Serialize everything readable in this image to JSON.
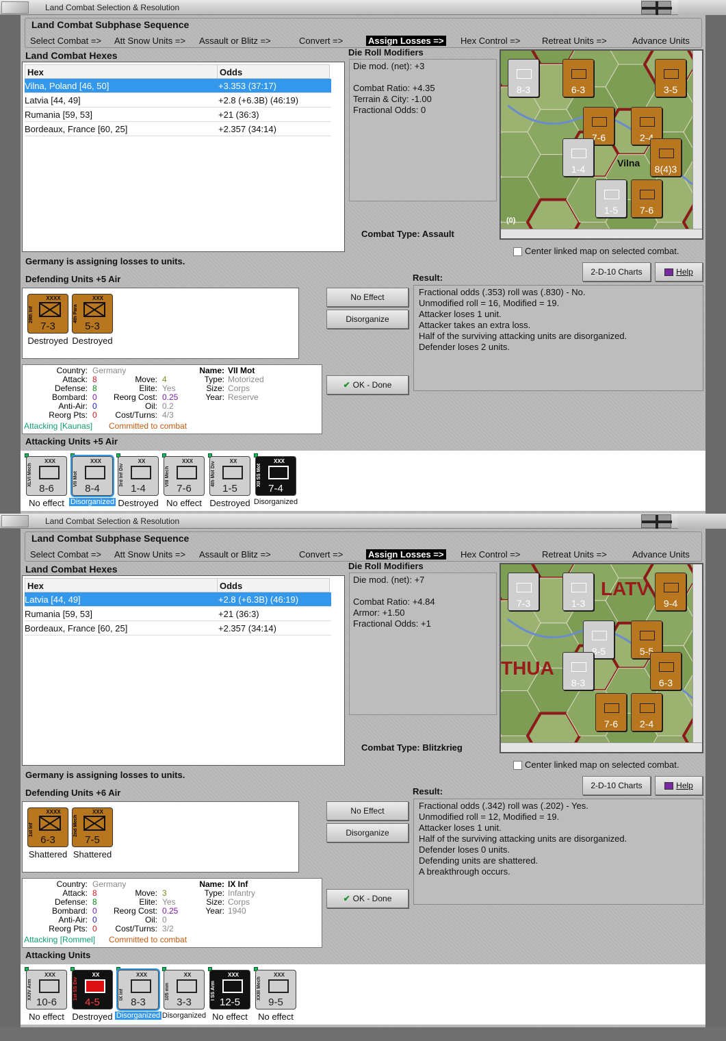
{
  "windows": [
    {
      "title": "Land Combat Selection & Resolution",
      "sequence_title": "Land Combat Subphase Sequence",
      "steps": [
        "Select Combat =>",
        "Att Snow Units =>",
        "Assault or Blitz =>",
        "Convert =>",
        "Assign Losses =>",
        "Hex Control =>",
        "Retreat Units =>",
        "Advance Units"
      ],
      "hexes_label": "Land Combat Hexes",
      "col_hex": "Hex",
      "col_odds": "Odds",
      "hexes": [
        {
          "hex": "Vilna, Poland [46, 50]",
          "odds": "+3.353 (37:17)"
        },
        {
          "hex": "Latvia [44, 49]",
          "odds": "+2.8 (+6.3B) (46:19)"
        },
        {
          "hex": "Rumania [59, 53]",
          "odds": "+21 (36:3)"
        },
        {
          "hex": "Bordeaux, France [60, 25]",
          "odds": "+2.357 (34:14)"
        }
      ],
      "drm_label": "Die Roll Modifiers",
      "drm_lines": [
        "Die mod. (net): +3",
        "",
        "Combat Ratio: +4.35",
        "Terrain & City: -1.00",
        "Fractional Odds: 0"
      ],
      "combat_type_label": "Combat Type:",
      "combat_type": "Assault",
      "center_map": "Center linked map on selected combat.",
      "map_labels": [
        "Vilna",
        "(0)"
      ],
      "map_counters": [
        "8-3",
        "6-3",
        "3-5",
        "7-6",
        "2-4",
        "1-4",
        "8(4)3",
        "1-5",
        "7-6"
      ],
      "status": "Germany is assigning losses to units.",
      "defending_label": "Defending Units +5 Air",
      "defenders": [
        {
          "name": "29th Inf",
          "size": "XXXX",
          "value": "7-3",
          "status": "Destroyed"
        },
        {
          "name": "4th Para",
          "size": "XXX",
          "value": "5-3",
          "status": "Destroyed"
        }
      ],
      "btn_no_effect": "No Effect",
      "btn_disorganize": "Disorganize",
      "btn_ok": "OK - Done",
      "btn_charts": "2-D-10 Charts",
      "btn_help": "Help",
      "result_label": "Result:",
      "result_lines": [
        "Fractional odds (.353) roll was (.830)  - No.",
        "Unmodified roll = 16, Modified = 19.",
        "Attacker loses 1 unit.",
        "Attacker takes an extra loss.",
        "Half of the surviving attacking units are disorganized.",
        "Defender loses 2 units."
      ],
      "info": {
        "country_label": "Country:",
        "country": "Germany",
        "attack_label": "Attack:",
        "attack": "8",
        "defense_label": "Defense:",
        "defense": "8",
        "bombard_label": "Bombard:",
        "bombard": "0",
        "antiair_label": "Anti-Air:",
        "antiair": "0",
        "reorg_pts_label": "Reorg Pts:",
        "reorg_pts": "0",
        "move_label": "Move:",
        "move": "4",
        "elite_label": "Elite:",
        "elite": "Yes",
        "reorg_cost_label": "Reorg Cost:",
        "reorg_cost": "0.25",
        "oil_label": "Oil:",
        "oil": "0.2",
        "cost_turns_label": "Cost/Turns:",
        "cost_turns": "4/3",
        "name_label": "Name:",
        "name": "VII Mot",
        "type_label": "Type:",
        "type": "Motorized",
        "size_label": "Size:",
        "size": "Corps",
        "year_label": "Year:",
        "year": "Reserve",
        "attacking": "Attacking [Kaunas]",
        "committed": "Committed to combat"
      },
      "attacking_label": "Attacking Units +5 Air",
      "attackers": [
        {
          "name": "XLVI Mech",
          "size": "XXX",
          "value": "8-6",
          "status": "No effect"
        },
        {
          "name": "VII Mot",
          "size": "XXX",
          "value": "8-4",
          "status": "Disorganized"
        },
        {
          "name": "3rd Inf Div",
          "size": "XX",
          "value": "1-4",
          "status": "Destroyed"
        },
        {
          "name": "VIII Mech",
          "size": "XXX",
          "value": "7-6",
          "status": "No effect"
        },
        {
          "name": "4th Mot Div",
          "size": "XX",
          "value": "1-5",
          "status": "Destroyed"
        },
        {
          "name": "XII SS Mot",
          "size": "XXX",
          "value": "7-4",
          "status": "Disorganized"
        }
      ]
    },
    {
      "title": "Land Combat Selection & Resolution",
      "sequence_title": "Land Combat Subphase Sequence",
      "steps": [
        "Select Combat =>",
        "Att Snow Units =>",
        "Assault or Blitz =>",
        "Convert =>",
        "Assign Losses =>",
        "Hex Control =>",
        "Retreat Units =>",
        "Advance Units"
      ],
      "hexes_label": "Land Combat Hexes",
      "col_hex": "Hex",
      "col_odds": "Odds",
      "hexes": [
        {
          "hex": "Latvia [44, 49]",
          "odds": "+2.8 (+6.3B) (46:19)"
        },
        {
          "hex": "Rumania [59, 53]",
          "odds": "+21 (36:3)"
        },
        {
          "hex": "Bordeaux, France [60, 25]",
          "odds": "+2.357 (34:14)"
        }
      ],
      "drm_label": "Die Roll Modifiers",
      "drm_lines": [
        "Die mod. (net): +7",
        "",
        "Combat Ratio: +4.84",
        "Armor: +1.50",
        "Fractional Odds: +1"
      ],
      "combat_type_label": "Combat Type:",
      "combat_type": "Blitzkrieg",
      "center_map": "Center linked map on selected combat.",
      "map_labels": [
        "LATV",
        "THUA"
      ],
      "map_counters": [
        "7-3",
        "1-3",
        "9-4",
        "8-5",
        "5-5",
        "8-3",
        "6-3",
        "7-6",
        "2-4"
      ],
      "status": "Germany is assigning losses to units.",
      "defending_label": "Defending Units +6 Air",
      "defenders": [
        {
          "name": "1st Inf",
          "size": "XXXX",
          "value": "6-3",
          "status": "Shattered"
        },
        {
          "name": "2nd Mech",
          "size": "XXX",
          "value": "7-5",
          "status": "Shattered"
        }
      ],
      "btn_no_effect": "No Effect",
      "btn_disorganize": "Disorganize",
      "btn_ok": "OK - Done",
      "btn_charts": "2-D-10 Charts",
      "btn_help": "Help",
      "result_label": "Result:",
      "result_lines": [
        "Fractional odds (.342) roll was (.202)  - Yes.",
        "Unmodified roll = 12, Modified = 19.",
        "Attacker loses 1 unit.",
        "Half of the surviving attacking units are disorganized.",
        "Defender loses 0 units.",
        "Defending units are shattered.",
        "A breakthrough occurs."
      ],
      "info": {
        "country_label": "Country:",
        "country": "Germany",
        "attack_label": "Attack:",
        "attack": "8",
        "defense_label": "Defense:",
        "defense": "8",
        "bombard_label": "Bombard:",
        "bombard": "0",
        "antiair_label": "Anti-Air:",
        "antiair": "0",
        "reorg_pts_label": "Reorg Pts:",
        "reorg_pts": "0",
        "move_label": "Move:",
        "move": "3",
        "elite_label": "Elite:",
        "elite": "Yes",
        "reorg_cost_label": "Reorg Cost:",
        "reorg_cost": "0.25",
        "oil_label": "Oil:",
        "oil": "0",
        "cost_turns_label": "Cost/Turns:",
        "cost_turns": "3/2",
        "name_label": "Name:",
        "name": "IX Inf",
        "type_label": "Type:",
        "type": "Infantry",
        "size_label": "Size:",
        "size": "Corps",
        "year_label": "Year:",
        "year": "1940",
        "attacking": "Attacking [Rommel]",
        "committed": "Committed to combat"
      },
      "attacking_label": "Attacking Units",
      "attackers": [
        {
          "name": "XXIV Arm",
          "size": "XXX",
          "value": "10-6",
          "status": "No effect"
        },
        {
          "name": "1st SS Div",
          "size": "XX",
          "value": "4-5",
          "status": "Destroyed"
        },
        {
          "name": "IX Inf",
          "size": "XXX",
          "value": "8-3",
          "status": "Disorganized"
        },
        {
          "name": "105 mm",
          "size": "XX",
          "value": "3-3",
          "status": "Disorganized"
        },
        {
          "name": "I SS Arm",
          "size": "XXX",
          "value": "12-5",
          "status": "No effect"
        },
        {
          "name": "XXIII Mech",
          "size": "XXX",
          "value": "9-5",
          "status": "No effect"
        }
      ]
    }
  ],
  "colors": {
    "selected": "#3398ec",
    "soviet_counter": "#b8761e",
    "german_counter": "#cfcfcf",
    "ss_counter": "#111111"
  }
}
